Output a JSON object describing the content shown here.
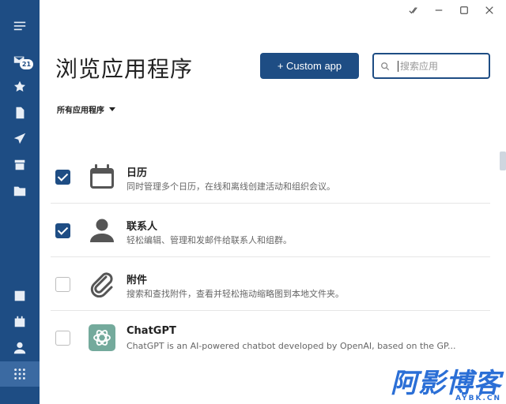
{
  "sidebar": {
    "mail_badge": "21",
    "top_icons": [
      "menu-icon",
      "mail-icon",
      "star-icon",
      "document-icon",
      "send-icon",
      "archive-icon",
      "folder-add-icon"
    ],
    "bottom_icons": [
      "notes-icon",
      "calendar-icon",
      "contacts-icon",
      "apps-grid-icon"
    ]
  },
  "header": {
    "title": "浏览应用程序",
    "custom_app_label": "+ Custom app",
    "search_placeholder": "搜索应用"
  },
  "filter": {
    "label": "所有应用程序"
  },
  "apps": [
    {
      "name": "日历",
      "desc": "同时管理多个日历，在线和离线创建活动和组织会议。",
      "checked": true,
      "icon": "calendar-app-icon"
    },
    {
      "name": "联系人",
      "desc": "轻松编辑、管理和发邮件给联系人和组群。",
      "checked": true,
      "icon": "contact-app-icon"
    },
    {
      "name": "附件",
      "desc": "搜索和查找附件，查看并轻松拖动缩略图到本地文件夹。",
      "checked": false,
      "icon": "paperclip-app-icon"
    },
    {
      "name": "ChatGPT",
      "desc": "ChatGPT is an AI-powered chatbot developed by OpenAI, based on the GP...",
      "checked": false,
      "icon": "chatgpt-app-icon"
    }
  ],
  "watermark": {
    "main": "阿影博客",
    "sub": "AYBK.CN"
  },
  "colors": {
    "sidebar": "#1e4d84",
    "accent": "#1e4d84",
    "chatgpt": "#74aa9c"
  }
}
